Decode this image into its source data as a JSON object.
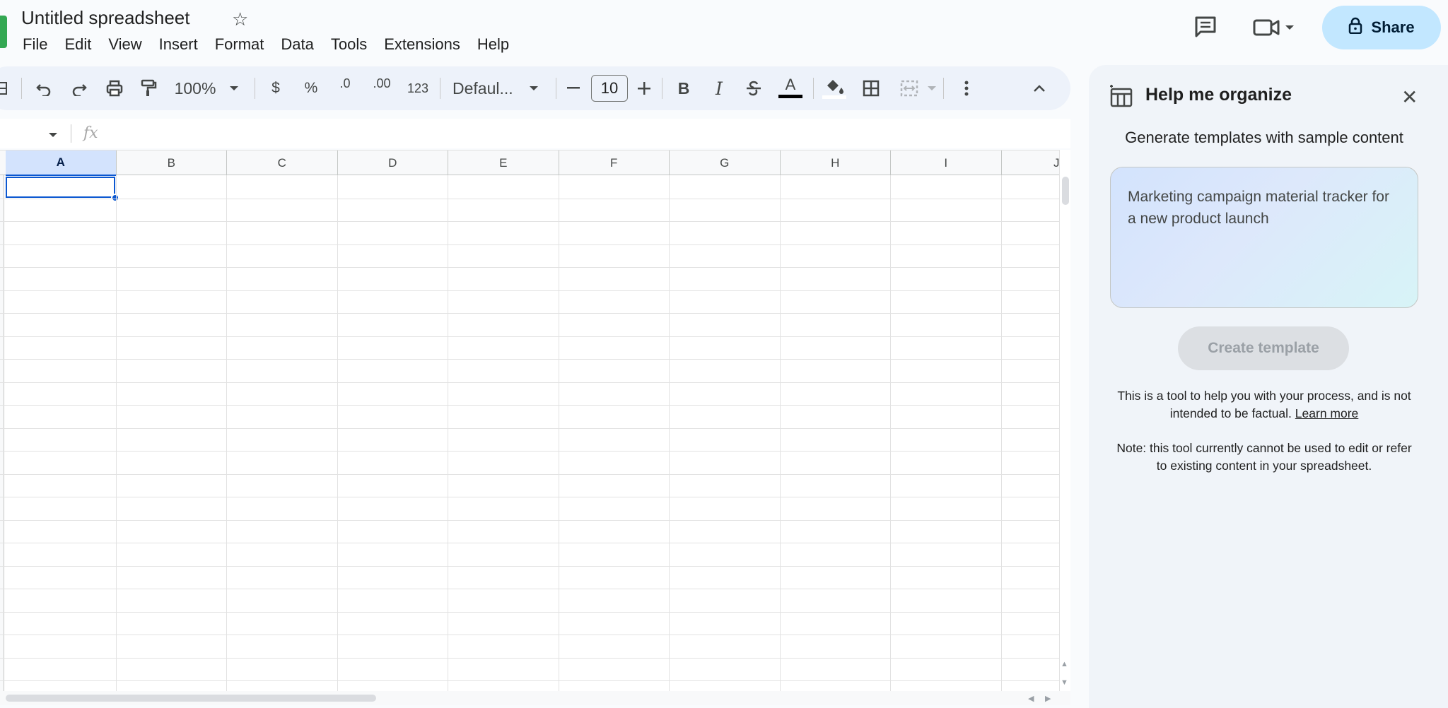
{
  "document": {
    "title": "Untitled spreadsheet"
  },
  "menu": [
    "File",
    "Edit",
    "View",
    "Insert",
    "Format",
    "Data",
    "Tools",
    "Extensions",
    "Help"
  ],
  "header": {
    "share_label": "Share"
  },
  "toolbar": {
    "zoom": "100%",
    "currency": "$",
    "percent": "%",
    "decrease_decimal": ".0",
    "increase_decimal": ".00",
    "number_format": "123",
    "font": "Defaul...",
    "font_size": "10",
    "bold": "B",
    "italic": "I",
    "text_color": "A",
    "text_color_value": "#000000"
  },
  "formula_bar": {
    "fx": "fx"
  },
  "grid": {
    "columns": [
      "A",
      "B",
      "C",
      "D",
      "E",
      "F",
      "G",
      "H",
      "I",
      "J"
    ],
    "selected_column": "A",
    "selected_cell": "A1"
  },
  "panel": {
    "title": "Help me organize",
    "subtitle": "Generate templates with sample content",
    "prompt_text": "Marketing campaign material tracker for a new product launch",
    "create_button": "Create template",
    "disclaimer": "This is a tool to help you with your process, and is not intended to be factual.",
    "learn_more": "Learn more",
    "note": "Note: this tool currently cannot be used to edit or refer to existing content in your spreadsheet."
  },
  "colors": {
    "accent": "#0b57d0",
    "share_bg": "#c2e7ff",
    "sheets_green": "#34a853",
    "panel_bg": "#f0f4f9"
  }
}
